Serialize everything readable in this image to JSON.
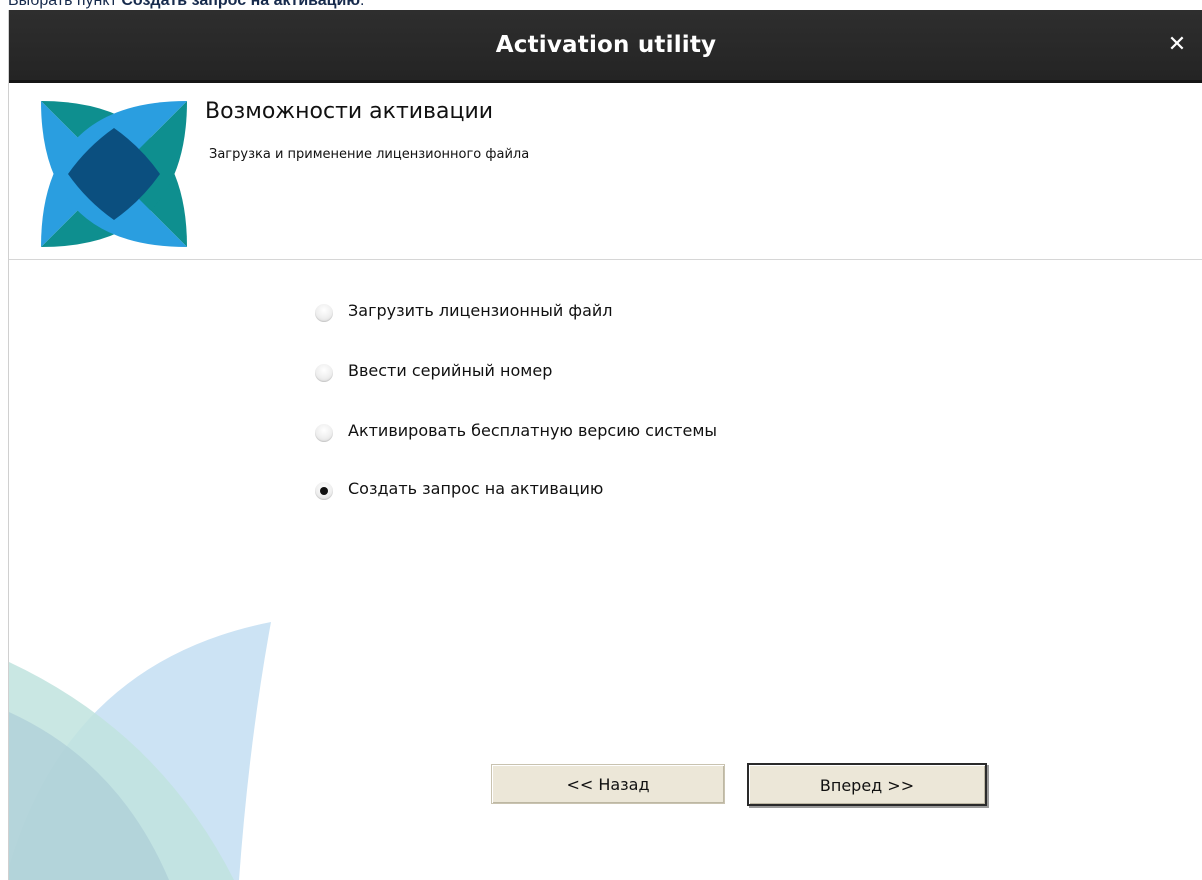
{
  "caption": {
    "prefix": "Выбрать пункт ",
    "bold": "Создать запрос на активацию",
    "suffix": "."
  },
  "window": {
    "title": "Activation utility",
    "close_icon": "close-icon"
  },
  "header": {
    "title": "Возможности активации",
    "subtitle": "Загрузка и применение лицензионного файла",
    "logo_icon": "app-logo-icon"
  },
  "options": [
    {
      "label": "Загрузить лицензионный файл",
      "checked": false
    },
    {
      "label": "Ввести серийный номер",
      "checked": false
    },
    {
      "label": "Активировать бесплатную версию системы",
      "checked": false
    },
    {
      "label": "Создать запрос на активацию",
      "checked": true
    }
  ],
  "buttons": {
    "back_label": "<< Назад",
    "next_label": "Вперед >>"
  },
  "colors": {
    "teal": "#0e8f8f",
    "blue": "#2a9ee0",
    "overlap": "#0b4f7f",
    "titlebar": "#2a2a2a",
    "button_bg": "#ece7d8"
  }
}
